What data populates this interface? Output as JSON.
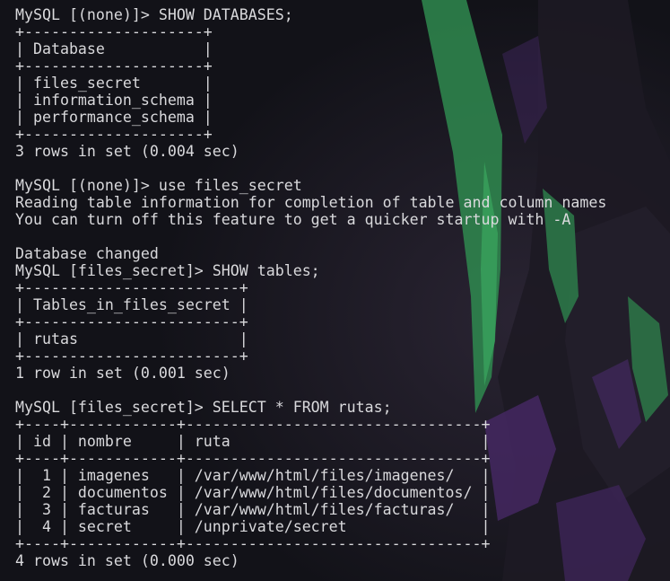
{
  "terminal": {
    "lines": [
      "MySQL [(none)]> SHOW DATABASES;",
      "+--------------------+",
      "| Database           |",
      "+--------------------+",
      "| files_secret       |",
      "| information_schema |",
      "| performance_schema |",
      "+--------------------+",
      "3 rows in set (0.004 sec)",
      "",
      "MySQL [(none)]> use files_secret",
      "Reading table information for completion of table and column names",
      "You can turn off this feature to get a quicker startup with -A",
      "",
      "Database changed",
      "MySQL [files_secret]> SHOW tables;",
      "+------------------------+",
      "| Tables_in_files_secret |",
      "+------------------------+",
      "| rutas                  |",
      "+------------------------+",
      "1 row in set (0.001 sec)",
      "",
      "MySQL [files_secret]> SELECT * FROM rutas;",
      "+----+------------+---------------------------------+",
      "| id | nombre     | ruta                            |",
      "+----+------------+---------------------------------+",
      "|  1 | imagenes   | /var/www/html/files/imagenes/   |",
      "|  2 | documentos | /var/www/html/files/documentos/ |",
      "|  3 | facturas   | /var/www/html/files/facturas/   |",
      "|  4 | secret     | /unprivate/secret               |",
      "+----+------------+---------------------------------+",
      "4 rows in set (0.000 sec)"
    ]
  },
  "colors": {
    "background": "#121218",
    "text": "#d9d9dc",
    "accent_green": "#2f8a4f",
    "accent_purple": "#4a2a6a"
  }
}
